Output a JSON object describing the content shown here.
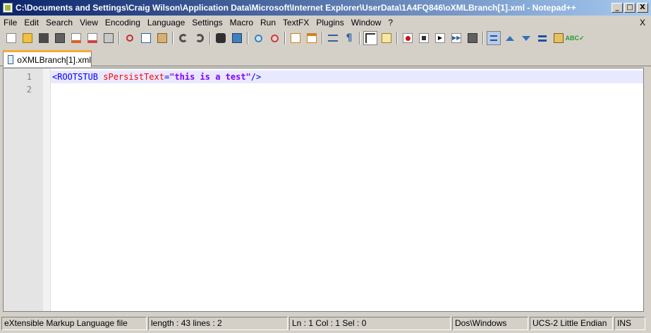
{
  "window": {
    "title": "C:\\Documents and Settings\\Craig Wilson\\Application Data\\Microsoft\\Internet Explorer\\UserData\\1A4FQ846\\oXMLBranch[1].xml - Notepad++",
    "buttons": {
      "minimize": "_",
      "maximize": "□",
      "close": "X"
    }
  },
  "menu": {
    "items": [
      "File",
      "Edit",
      "Search",
      "View",
      "Encoding",
      "Language",
      "Settings",
      "Macro",
      "Run",
      "TextFX",
      "Plugins",
      "Window",
      "?"
    ],
    "close": "X"
  },
  "toolbar": {
    "icons": [
      "new-file-icon",
      "open-file-icon",
      "save-icon",
      "save-all-icon",
      "close-icon",
      "close-all-icon",
      "print-icon",
      "cut-icon",
      "copy-icon",
      "paste-icon",
      "undo-icon",
      "redo-icon",
      "find-icon",
      "replace-icon",
      "zoom-in-icon",
      "zoom-out-icon",
      "sync-vertical-icon",
      "sync-horizontal-icon",
      "word-wrap-icon",
      "show-all-chars-icon",
      "indent-guide-icon",
      "user-lang-icon",
      "record-macro-icon",
      "stop-record-icon",
      "play-macro-icon",
      "run-multiple-icon",
      "save-macro-icon",
      "collapse-icon",
      "arrow-up-icon",
      "arrow-down-icon",
      "sort-icon",
      "folder-search-icon",
      "spellcheck-icon"
    ]
  },
  "tab": {
    "label": "oXMLBranch[1].xml"
  },
  "editor": {
    "lines": [
      {
        "number": "1",
        "tag_open": "<ROOTSTUB ",
        "attr": "sPersistText",
        "eq": "=",
        "value": "\"this is a test\"",
        "tag_close": "/>"
      },
      {
        "number": "2"
      }
    ]
  },
  "status": {
    "filetype": "eXtensible Markup Language file",
    "length": "length : 43    lines : 2",
    "position": "Ln : 1    Col : 1    Sel : 0",
    "eol": "Dos\\Windows",
    "encoding": "UCS-2 Little Endian",
    "mode": "INS"
  },
  "colors": {
    "title_bar": "#0a246a",
    "tab_accent": "#f7a934",
    "current_line": "#e8e8ff",
    "xml_tag": "#0000ff",
    "xml_attr": "#ff0000",
    "xml_string": "#8000ff"
  }
}
